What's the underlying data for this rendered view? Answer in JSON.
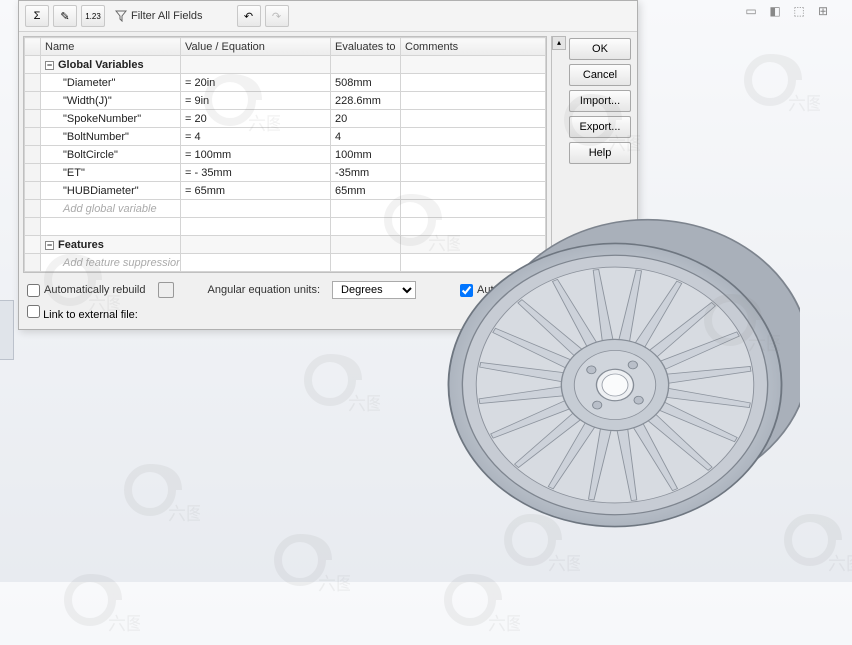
{
  "toolbar": {
    "filter_label": "Filter All Fields"
  },
  "grid": {
    "headers": {
      "name": "Name",
      "value": "Value / Equation",
      "eval": "Evaluates to",
      "comments": "Comments"
    },
    "group_globals": "Global Variables",
    "group_features": "Features",
    "placeholder_global": "Add global variable",
    "placeholder_feature": "Add feature suppression",
    "rows": [
      {
        "name": "\"Diameter\"",
        "value": "= 20in",
        "eval": "508mm",
        "comments": ""
      },
      {
        "name": "\"Width(J)\"",
        "value": "= 9in",
        "eval": "228.6mm",
        "comments": ""
      },
      {
        "name": "\"SpokeNumber\"",
        "value": "= 20",
        "eval": "20",
        "comments": ""
      },
      {
        "name": "\"BoltNumber\"",
        "value": "= 4",
        "eval": "4",
        "comments": ""
      },
      {
        "name": "\"BoltCircle\"",
        "value": "= 100mm",
        "eval": "100mm",
        "comments": ""
      },
      {
        "name": "\"ET\"",
        "value": "= - 35mm",
        "eval": "-35mm",
        "comments": ""
      },
      {
        "name": "\"HUBDiameter\"",
        "value": "= 65mm",
        "eval": "65mm",
        "comments": ""
      }
    ]
  },
  "buttons": {
    "ok": "OK",
    "cancel": "Cancel",
    "import": "Import...",
    "export": "Export...",
    "help": "Help"
  },
  "opts": {
    "auto_rebuild": "Automatically rebuild",
    "angular_label": "Angular equation units:",
    "angular_value": "Degrees",
    "auto_solve": "Automatic solve order",
    "link_external": "Link to external file:"
  }
}
